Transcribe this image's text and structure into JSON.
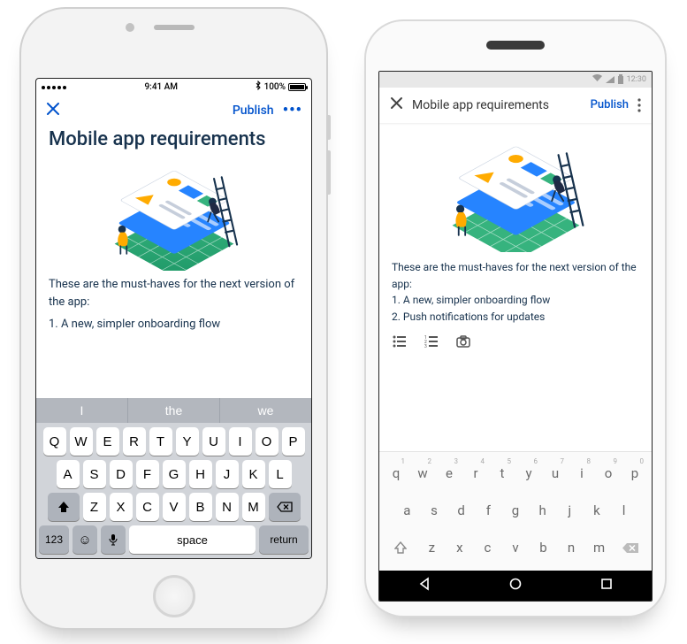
{
  "ios": {
    "status": {
      "time": "9:41 AM",
      "battery_pct": "100%"
    },
    "nav": {
      "publish_label": "Publish",
      "more_label": "•••"
    },
    "title": "Mobile app requirements",
    "body": {
      "intro": "These are the must-haves for the next version of the app:",
      "item1": "1. A new, simpler onboarding flow"
    },
    "keyboard": {
      "suggestions": [
        "I",
        "the",
        "we"
      ],
      "row1": [
        "Q",
        "W",
        "E",
        "R",
        "T",
        "Y",
        "U",
        "I",
        "O",
        "P"
      ],
      "row2": [
        "A",
        "S",
        "D",
        "F",
        "G",
        "H",
        "J",
        "K",
        "L"
      ],
      "row3": [
        "Z",
        "X",
        "C",
        "V",
        "B",
        "N",
        "M"
      ],
      "num_label": "123",
      "space_label": "space",
      "return_label": "return"
    }
  },
  "android": {
    "status": {
      "time": "12:30"
    },
    "nav": {
      "title": "Mobile app requirements",
      "publish_label": "Publish"
    },
    "body": {
      "intro": "These are the must-haves for the next version of the app:",
      "item1": "1. A new, simpler onboarding flow",
      "item2": "2. Push notifications for updates"
    },
    "keyboard": {
      "row1": [
        {
          "k": "q",
          "n": "1"
        },
        {
          "k": "w",
          "n": "2"
        },
        {
          "k": "e",
          "n": "3"
        },
        {
          "k": "r",
          "n": "4"
        },
        {
          "k": "t",
          "n": "5"
        },
        {
          "k": "y",
          "n": "6"
        },
        {
          "k": "u",
          "n": "7"
        },
        {
          "k": "i",
          "n": "8"
        },
        {
          "k": "o",
          "n": "9"
        },
        {
          "k": "p",
          "n": "0"
        }
      ],
      "row2": [
        "a",
        "s",
        "d",
        "f",
        "g",
        "h",
        "j",
        "k",
        "l"
      ],
      "row3": [
        "z",
        "x",
        "c",
        "v",
        "b",
        "n",
        "m"
      ]
    }
  },
  "colors": {
    "accent": "#0052cc",
    "text": "#17324d"
  }
}
